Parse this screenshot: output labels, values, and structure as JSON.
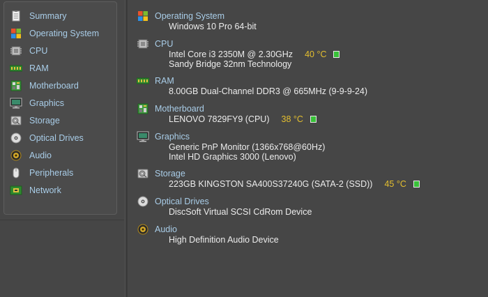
{
  "sidebar": {
    "items": [
      {
        "label": "Summary",
        "icon": "summary-icon"
      },
      {
        "label": "Operating System",
        "icon": "windows-icon"
      },
      {
        "label": "CPU",
        "icon": "cpu-icon"
      },
      {
        "label": "RAM",
        "icon": "ram-icon"
      },
      {
        "label": "Motherboard",
        "icon": "motherboard-icon"
      },
      {
        "label": "Graphics",
        "icon": "monitor-icon"
      },
      {
        "label": "Storage",
        "icon": "hard-drive-icon"
      },
      {
        "label": "Optical Drives",
        "icon": "disc-icon"
      },
      {
        "label": "Audio",
        "icon": "speaker-icon"
      },
      {
        "label": "Peripherals",
        "icon": "mouse-icon"
      },
      {
        "label": "Network",
        "icon": "network-icon"
      }
    ]
  },
  "summary": {
    "os": {
      "title": "Operating System",
      "lines": [
        "Windows 10 Pro 64-bit"
      ]
    },
    "cpu": {
      "title": "CPU",
      "lines": [
        "Intel Core i3 2350M @ 2.30GHz",
        "Sandy Bridge 32nm Technology"
      ],
      "temp": "40 °C"
    },
    "ram": {
      "title": "RAM",
      "lines": [
        "8.00GB Dual-Channel DDR3 @ 665MHz (9-9-9-24)"
      ]
    },
    "motherboard": {
      "title": "Motherboard",
      "lines": [
        "LENOVO 7829FY9 (CPU)"
      ],
      "temp": "38 °C"
    },
    "graphics": {
      "title": "Graphics",
      "lines": [
        "Generic PnP Monitor (1366x768@60Hz)",
        "Intel HD Graphics 3000 (Lenovo)"
      ]
    },
    "storage": {
      "title": "Storage",
      "lines": [
        "223GB KINGSTON SA400S37240G (SATA-2 (SSD))"
      ],
      "temp": "45 °C"
    },
    "optical": {
      "title": "Optical Drives",
      "lines": [
        "DiscSoft Virtual SCSI CdRom Device"
      ]
    },
    "audio": {
      "title": "Audio",
      "lines": [
        "High Definition Audio Device"
      ]
    }
  },
  "colors": {
    "background": "#464646",
    "label_blue": "#a9cde8",
    "value_text": "#ececec",
    "temperature": "#e4bf2f",
    "temp_indicator": "#38c138"
  }
}
